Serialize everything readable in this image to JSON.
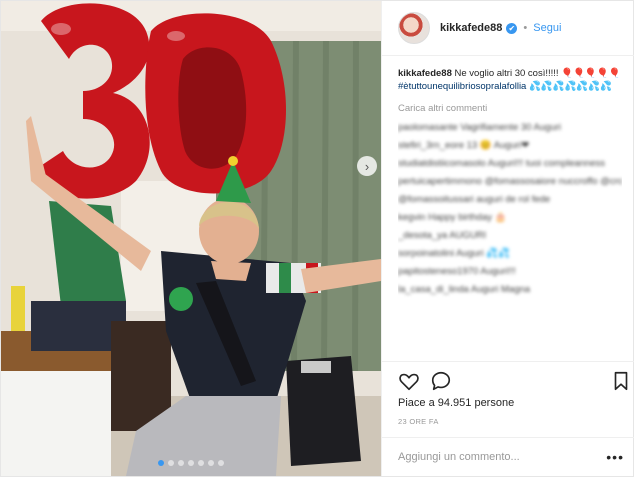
{
  "post": {
    "user": {
      "username": "kikkafede88",
      "verified_mark": "✔",
      "separator": "•",
      "follow_label": "Segui"
    },
    "caption": {
      "username": "kikkafede88",
      "text": "Ne voglio altri 30 così!!!!! 🎈🎈🎈🎈🎈",
      "hashtag": "#ètuttounequilibriosopralafollia",
      "emoji": "💦💦💦💦💦💦💦"
    },
    "load_more_label": "Carica altri commenti",
    "blurred_comments": [
      "paolomasante Vagrifiamente 30 Auguri",
      "stefiri_3rn_eore 13 😊 Auguri❤",
      "studiatdistiicomasolo Auguri!!! tuoi compleanness",
      "pertuicapertimmono @fomassosaiore nuccroffo @crossrferi",
      "@fomassoitussari auguri de rol fede",
      "kegvin Happy birthday 🎂",
      "_desota_ya AUGURI",
      "sorpoinatolini Auguri 💦💦",
      "papitosteneso1970 Auguri!!!",
      "la_casa_di_linda Auguri Magna"
    ],
    "likes_text": "Piace a 94.951 persone",
    "timestamp": "23 ORE FA",
    "comment_input": {
      "placeholder": "Aggiungi un commento...",
      "value": ""
    },
    "more_label": "•••",
    "carousel": {
      "dot_count": 7,
      "active_index": 0,
      "next_arrow": "›"
    },
    "photo": {
      "balloon_number": "30"
    },
    "colors": {
      "accent": "#3897f0",
      "balloon": "#c8161d",
      "text": "#262626",
      "muted": "#999999"
    },
    "icons": [
      "heart-icon",
      "comment-bubble-icon",
      "bookmark-icon",
      "verified-badge-icon",
      "more-options-icon"
    ]
  }
}
